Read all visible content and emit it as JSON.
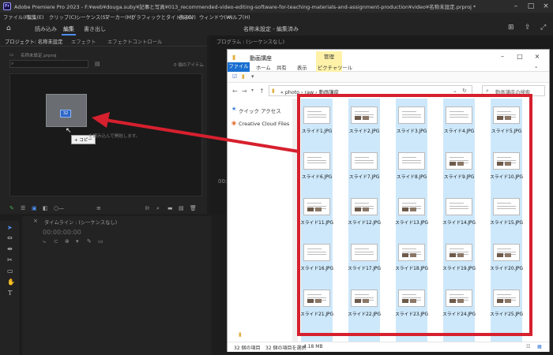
{
  "premiere": {
    "logo": "Pr",
    "window_title": "Adobe Premiere Pro 2023 - F:¥web¥douga.suby¥記事と写真¥013_recommended-video-editing-software-for-teaching-materials-and-assignment-production¥video¥名称未設定.prproj *",
    "menu": [
      "ファイル(F)",
      "編集(E)",
      "クリップ(C)",
      "シーケンス(S)",
      "マーカー(M)",
      "グラフィックとタイトル(G)",
      "表示(V)",
      "ウィンドウ(W)",
      "ヘルプ(H)"
    ],
    "workspace_tabs": [
      "読み込み",
      "編集",
      "書き出し"
    ],
    "document_title": "名称未設定 - 編集済み",
    "project_panel": {
      "tabs": [
        "プロジェクト: 名称未設定",
        "エフェクト",
        "エフェクトコントロール"
      ],
      "project_file": "名称未設定.prproj",
      "item_count": "0 個のアイテム",
      "drag_badge": "32",
      "copy_tooltip": "+ コピー",
      "import_hint": "を読み込んで開始します。"
    },
    "program_panel": {
      "tab": "プログラム : (シーケンスなし)",
      "timecode": "00:"
    },
    "timeline": {
      "tab": "タイムライン : (シーケンスなし)",
      "timecode": "00:00:00:00"
    }
  },
  "explorer": {
    "title": "動画講座",
    "manage_tab": "管理",
    "ribbon_tabs": [
      "ファイル",
      "ホーム",
      "共有",
      "表示",
      "ピクチャツール"
    ],
    "breadcrumb": "« photo › raw › 動画講座",
    "search_placeholder": "動画講座の検索",
    "nav_items": [
      "クイック アクセス",
      "Creative Cloud Files"
    ],
    "files": [
      "スライド1.JPG",
      "スライド2.JPG",
      "スライド3.JPG",
      "スライド4.JPG",
      "スライド5.JPG",
      "スライド6.JPG",
      "スライド7.JPG",
      "スライド8.JPG",
      "スライド9.JPG",
      "スライド10.JPG",
      "スライド11.JPG",
      "スライド12.JPG",
      "スライド13.JPG",
      "スライド14.JPG",
      "スライド15.JPG",
      "スライド16.JPG",
      "スライド17.JPG",
      "スライド18.JPG",
      "スライド19.JPG",
      "スライド20.JPG",
      "スライド21.JPG",
      "スライド22.JPG",
      "スライド23.JPG",
      "スライド24.JPG",
      "スライド25.JPG"
    ],
    "status": {
      "count": "32 個の項目",
      "selected": "32 個の項目を選択",
      "size": "4.18 MB"
    }
  },
  "colors": {
    "annotation_red": "#d6202e",
    "selection_blue": "#cde8fb",
    "premiere_accent": "#4d8df0"
  }
}
